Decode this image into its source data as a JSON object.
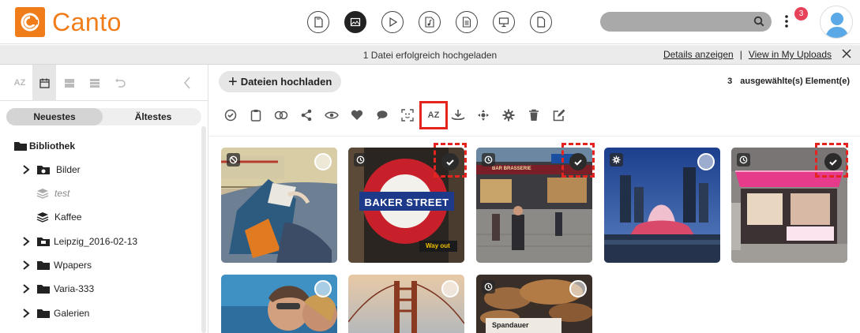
{
  "app": {
    "logo_text": "Canto",
    "brand_color": "#f07d1a"
  },
  "header": {
    "filter_icons": [
      "all-files-icon",
      "image-icon",
      "video-icon",
      "audio-icon",
      "document-icon",
      "presentation-icon",
      "other-file-icon"
    ],
    "active_filter": "image-icon",
    "search": {
      "placeholder": "",
      "value": ""
    },
    "notification_count": "3"
  },
  "banner": {
    "message": "1 Datei erfolgreich hochgeladen",
    "details_link": "Details anzeigen",
    "separator": "|",
    "uploads_link": "View in My Uploads"
  },
  "sidebar": {
    "tabs": [
      "AZ",
      "calendar-icon",
      "stack-icon",
      "layers-icon",
      "undo-icon",
      "collapse-icon"
    ],
    "sort_options": [
      "Neuestes",
      "Ältestes"
    ],
    "sort_active": "Neuestes",
    "tree": [
      {
        "label": "Bibliothek",
        "icon": "folder-open-icon",
        "level": 0
      },
      {
        "label": "Bilder",
        "icon": "folder-cloud-icon",
        "level": 1,
        "expandable": true
      },
      {
        "label": "test",
        "icon": "album-icon",
        "level": 1,
        "muted": true
      },
      {
        "label": "Kaffee",
        "icon": "album-icon",
        "level": 1
      },
      {
        "label": "Leipzig_2016-02-13",
        "icon": "folder-archive-icon",
        "level": 1,
        "expandable": true
      },
      {
        "label": "Wpapers",
        "icon": "folder-icon",
        "level": 1,
        "expandable": true
      },
      {
        "label": "Varia-333",
        "icon": "folder-icon",
        "level": 1,
        "expandable": true
      },
      {
        "label": "Galerien",
        "icon": "folder-icon",
        "level": 1,
        "expandable": true
      }
    ]
  },
  "main": {
    "upload_button": "Dateien hochladen",
    "selected_count": "3",
    "selected_label": "ausgewählte(s) Element(e)",
    "toolbar": [
      "check-circle-icon",
      "clipboard-icon",
      "link-icon",
      "share-icon",
      "eye-icon",
      "heart-icon",
      "comment-icon",
      "face-scan-icon",
      "AZ",
      "download-icon",
      "move-icon",
      "settings-icon",
      "trash-icon",
      "edit-icon"
    ],
    "highlight_color": "#e52420",
    "thumbnails": [
      {
        "name": "train-traveler",
        "badge": "blocked-icon",
        "selected": false,
        "highlighted": false
      },
      {
        "name": "baker-street",
        "badge": "clock-icon",
        "selected": true,
        "highlighted": true,
        "sign_text": "BAKER STREET",
        "sign_sub": "Way out"
      },
      {
        "name": "paris-street",
        "badge": "clock-icon",
        "selected": true,
        "highlighted": true,
        "shop_text": "BAR BRASSERIE"
      },
      {
        "name": "fountain-night",
        "badge": "gear-icon",
        "selected": false,
        "highlighted": false
      },
      {
        "name": "candy-shop",
        "badge": "clock-icon",
        "selected": true,
        "highlighted": true
      },
      {
        "name": "couple-selfie",
        "badge": "",
        "selected": false,
        "highlighted": false
      },
      {
        "name": "golden-gate",
        "badge": "",
        "selected": false,
        "highlighted": false
      },
      {
        "name": "bakery",
        "badge": "clock-icon",
        "selected": false,
        "highlighted": false,
        "label_text": "Spandauer"
      }
    ]
  }
}
